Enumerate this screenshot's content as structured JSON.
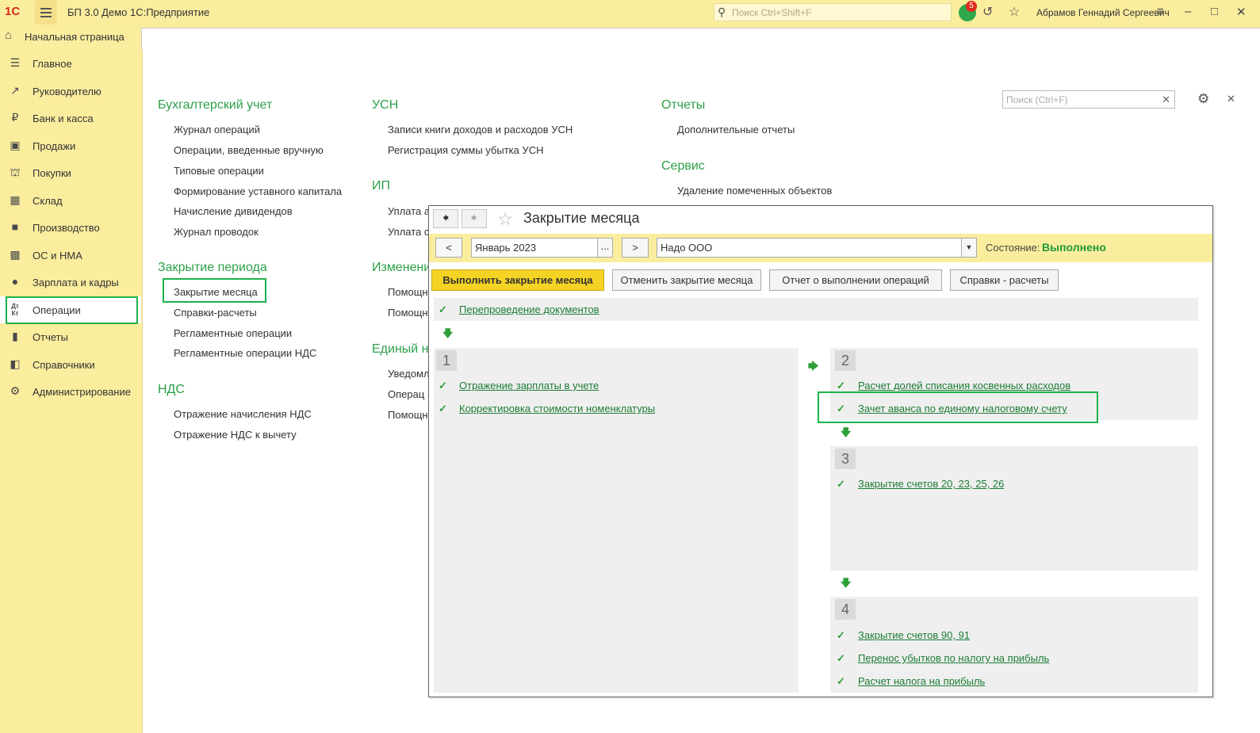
{
  "titlebar": {
    "logo": "1С",
    "app_title": "БП 3.0 Демо 1С:Предприятие",
    "search_placeholder": "Поиск Ctrl+Shift+F",
    "notifications_count": "5",
    "user_name": "Абрамов Геннадий Сергеевич"
  },
  "home_tab": {
    "label": "Начальная страница"
  },
  "sidebar": {
    "items": [
      {
        "label": "Главное",
        "icon": "menu-icon"
      },
      {
        "label": "Руководителю",
        "icon": "trend-icon"
      },
      {
        "label": "Банк и касса",
        "icon": "ruble-icon"
      },
      {
        "label": "Продажи",
        "icon": "bag-icon"
      },
      {
        "label": "Покупки",
        "icon": "cart-icon"
      },
      {
        "label": "Склад",
        "icon": "warehouse-icon"
      },
      {
        "label": "Производство",
        "icon": "factory-icon"
      },
      {
        "label": "ОС и НМА",
        "icon": "truck-icon"
      },
      {
        "label": "Зарплата и кадры",
        "icon": "person-icon"
      },
      {
        "label": "Операции",
        "icon": "dt-kt-icon"
      },
      {
        "label": "Отчеты",
        "icon": "chart-icon"
      },
      {
        "label": "Справочники",
        "icon": "book-icon"
      },
      {
        "label": "Администрирование",
        "icon": "gear-icon"
      }
    ]
  },
  "panel_search": {
    "placeholder": "Поиск (Ctrl+F)"
  },
  "sections": {
    "accounting": {
      "title": "Бухгалтерский учет",
      "items": [
        "Журнал операций",
        "Операции, введенные вручную",
        "Типовые операции",
        "Формирование уставного капитала",
        "Начисление дивидендов",
        "Журнал проводок"
      ]
    },
    "period_close": {
      "title": "Закрытие периода",
      "items": [
        "Закрытие месяца",
        "Справки-расчеты",
        "Регламентные операции",
        "Регламентные операции НДС"
      ]
    },
    "vat": {
      "title": "НДС",
      "items": [
        "Отражение начисления НДС",
        "Отражение НДС к вычету"
      ]
    },
    "usn": {
      "title": "УСН",
      "items": [
        "Записи книги доходов и расходов УСН",
        "Регистрация суммы убытка УСН"
      ]
    },
    "ip": {
      "title": "ИП",
      "items": [
        "Уплата а",
        "Уплата с"
      ]
    },
    "changes": {
      "title": "Изменени",
      "items": [
        "Помощн",
        "Помощн"
      ]
    },
    "single": {
      "title": "Единый н",
      "items": [
        "Уведомл",
        "Операц",
        "Помощн"
      ]
    },
    "reports": {
      "title": "Отчеты",
      "items": [
        "Дополнительные отчеты"
      ]
    },
    "service": {
      "title": "Сервис",
      "items": [
        "Удаление помеченных объектов"
      ]
    }
  },
  "modal": {
    "title": "Закрытие месяца",
    "prev_label": "<",
    "next_label": ">",
    "period": "Январь 2023",
    "period_dots": "...",
    "org": "Надо ООО",
    "status_label": "Состояние:",
    "status_value": "Выполнено",
    "buttons": {
      "run": "Выполнить закрытие месяца",
      "cancel": "Отменить закрытие месяца",
      "report": "Отчет о выполнении операций",
      "calcs": "Справки - расчеты"
    },
    "repost": "Перепроведение документов",
    "steps": [
      {
        "num": "1",
        "items": [
          "Отражение зарплаты в учете",
          "Корректировка стоимости номенклатуры"
        ]
      },
      {
        "num": "2",
        "items": [
          "Расчет долей списания косвенных расходов",
          "Зачет аванса по единому налоговому счету"
        ]
      },
      {
        "num": "3",
        "items": [
          "Закрытие счетов 20, 23, 25, 26"
        ]
      },
      {
        "num": "4",
        "items": [
          "Закрытие счетов 90, 91",
          "Перенос убытков по налогу на прибыль",
          "Расчет налога на прибыль"
        ]
      }
    ]
  },
  "colors": {
    "accent_yellow": "#fbed9e",
    "link_green": "#1c7d34",
    "highlight_green": "#1eb24a",
    "primary_button": "#f5d324"
  }
}
